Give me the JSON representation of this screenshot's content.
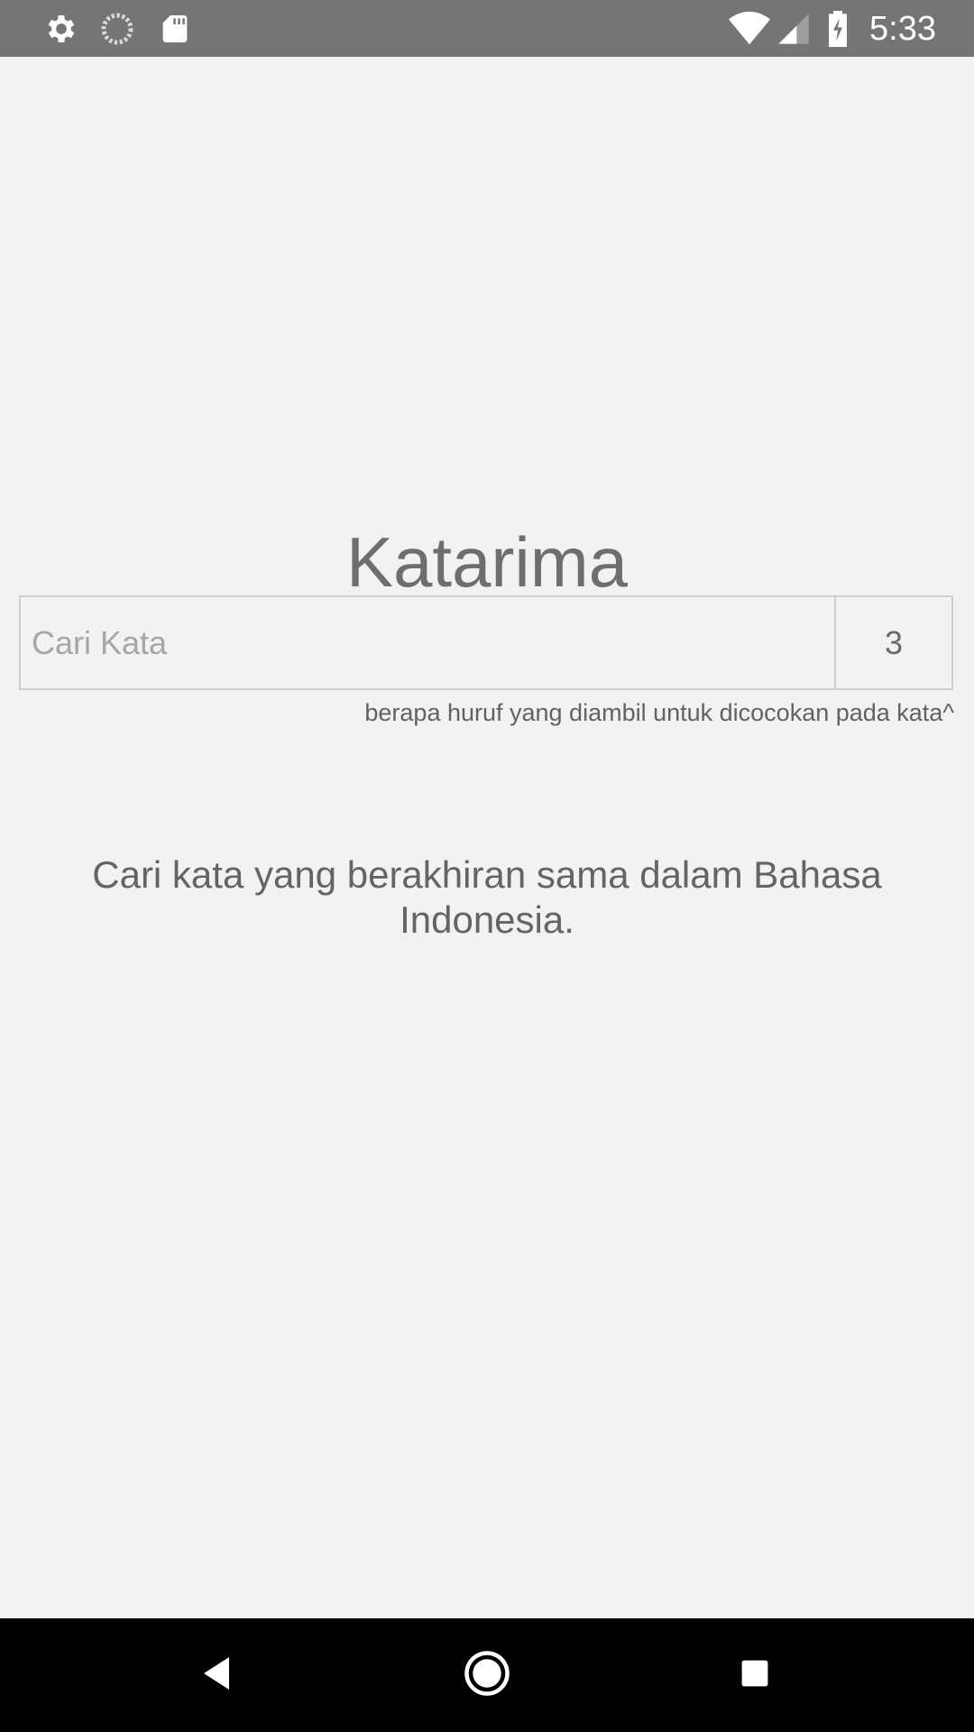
{
  "status_bar": {
    "time": "5:33",
    "left_icons": [
      "gear-icon",
      "sync-icon",
      "sd-card-icon"
    ],
    "right_icons": [
      "wifi-icon",
      "signal-icon",
      "battery-charging-icon"
    ]
  },
  "app": {
    "title": "Katarima",
    "search": {
      "placeholder": "Cari Kata",
      "value": ""
    },
    "letter_count": "3",
    "hint": "berapa huruf yang diambil untuk dicocokan pada kata^",
    "description": "Cari kata yang berakhiran sama dalam Bahasa Indonesia."
  },
  "nav_bar": {
    "buttons": [
      "back-icon",
      "home-icon",
      "recents-icon"
    ]
  }
}
